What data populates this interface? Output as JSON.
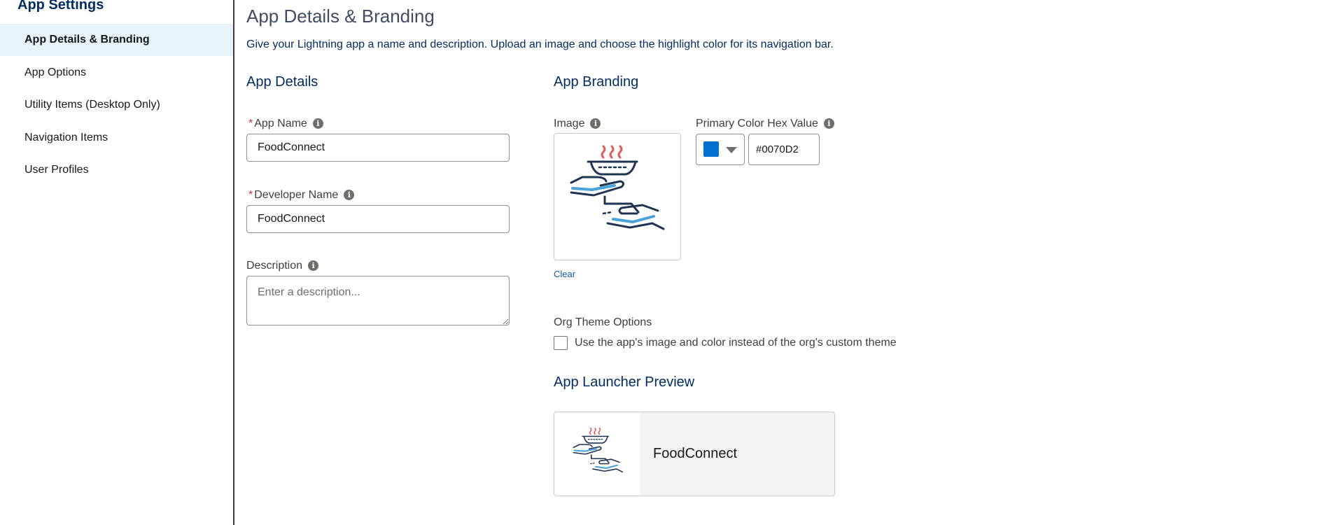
{
  "sidebar": {
    "title": "App Settings",
    "items": [
      {
        "label": "App Details & Branding",
        "active": true
      },
      {
        "label": "App Options",
        "active": false
      },
      {
        "label": "Utility Items (Desktop Only)",
        "active": false
      },
      {
        "label": "Navigation Items",
        "active": false
      },
      {
        "label": "User Profiles",
        "active": false
      }
    ]
  },
  "page": {
    "title": "App Details & Branding",
    "description": "Give your Lightning app a name and description. Upload an image and choose the highlight color for its navigation bar."
  },
  "app_details": {
    "section_title": "App Details",
    "required_marker": "*",
    "app_name_label": "App Name",
    "app_name_value": "FoodConnect",
    "developer_name_label": "Developer Name",
    "developer_name_value": "FoodConnect",
    "description_label": "Description",
    "description_placeholder": "Enter a description..."
  },
  "app_branding": {
    "section_title": "App Branding",
    "image_label": "Image",
    "clear_label": "Clear",
    "primary_color_label": "Primary Color Hex Value",
    "primary_color_value": "#0070D2",
    "org_theme_title": "Org Theme Options",
    "org_theme_checkbox_label": "Use the app's image and color instead of the org's custom theme",
    "org_theme_checked": false
  },
  "launcher_preview": {
    "section_title": "App Launcher Preview",
    "app_label": "FoodConnect"
  },
  "icons": {
    "info": "info-icon",
    "logo": "food-serving-hands-icon",
    "dropdown": "caret-down-icon"
  },
  "colors": {
    "accent": "#0070D2",
    "heading": "#032d60",
    "required": "#c23934",
    "active_bg": "#e8f4fc"
  }
}
